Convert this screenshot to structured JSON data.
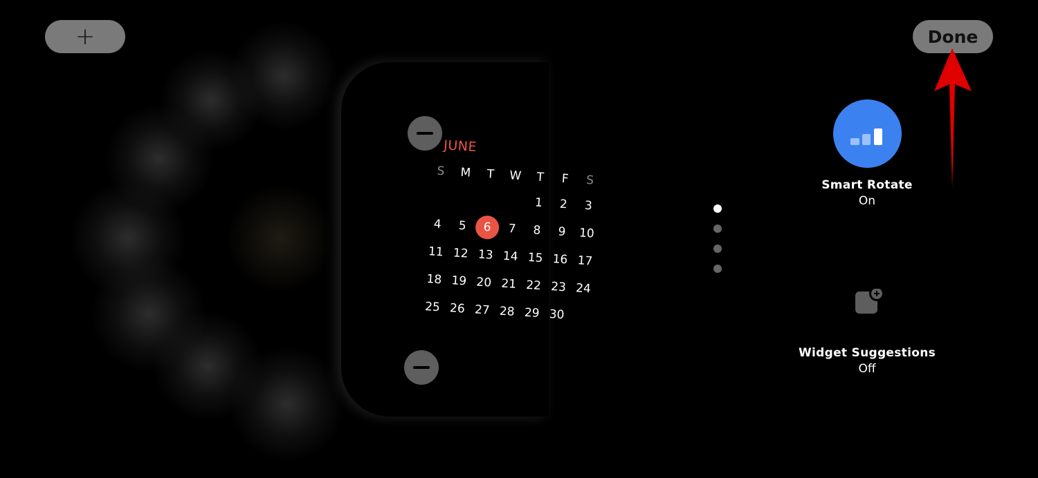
{
  "top_bar": {
    "add_label": "+",
    "done_label": "Done"
  },
  "calendar": {
    "month": "JUNE",
    "weekdays": [
      "S",
      "M",
      "T",
      "W",
      "T",
      "F",
      "S"
    ],
    "today": "6",
    "weeks": [
      [
        "",
        "",
        "",
        "",
        "1",
        "2",
        "3"
      ],
      [
        "4",
        "5",
        "6",
        "7",
        "8",
        "9",
        "10"
      ],
      [
        "11",
        "12",
        "13",
        "14",
        "15",
        "16",
        "17"
      ],
      [
        "18",
        "19",
        "20",
        "21",
        "22",
        "23",
        "24"
      ],
      [
        "25",
        "26",
        "27",
        "28",
        "29",
        "30",
        ""
      ]
    ]
  },
  "page_indicator": {
    "count": 4,
    "active_index": 0
  },
  "options": {
    "smart_rotate": {
      "title": "Smart Rotate",
      "status": "On",
      "icon": "bars-icon"
    },
    "widget_suggestions": {
      "title": "Widget Suggestions",
      "status": "Off",
      "icon": "widget-add-icon"
    }
  },
  "colors": {
    "accent_red": "#ea5444",
    "smart_rotate_blue": "#3b82f0",
    "annotation_arrow": "#e00000"
  }
}
